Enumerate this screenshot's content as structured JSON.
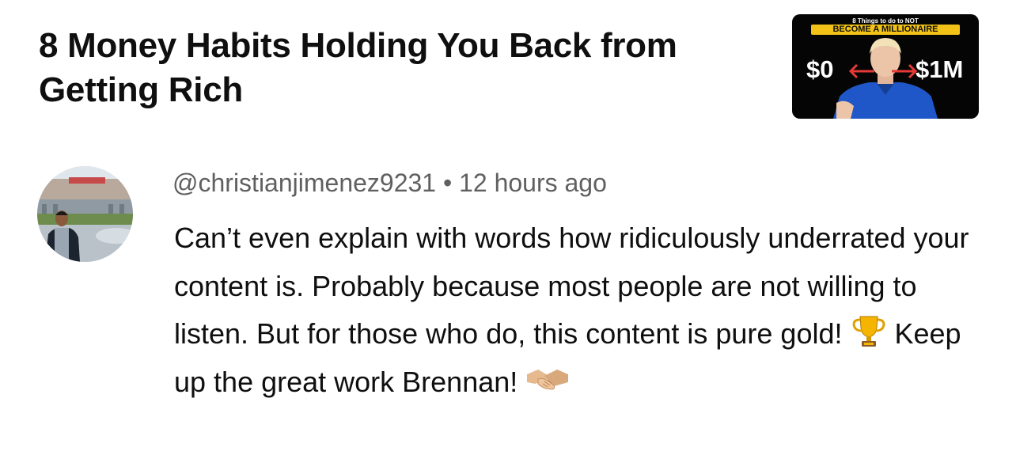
{
  "video": {
    "title": "8 Money Habits Holding You Back from Getting Rich",
    "thumbnail": {
      "subline": "8 Things to do to NOT",
      "banner": "BECOME A MILLIONAIRE",
      "left_amount": "$0",
      "right_amount": "$1M",
      "banner_color": "#f2c316",
      "arrow_color": "#e53935"
    }
  },
  "comment": {
    "author": "@christianjimenez9231",
    "separator": "•",
    "time": "12 hours ago",
    "text_part1": "Can’t even explain with words how ridiculously underrated your content is. Probably because most people are not willing to listen. But for those who do, this content is pure gold! ",
    "text_part2": " Keep up the great work Brennan! ",
    "emoji_1": "trophy-icon",
    "emoji_2": "handshake-icon"
  }
}
